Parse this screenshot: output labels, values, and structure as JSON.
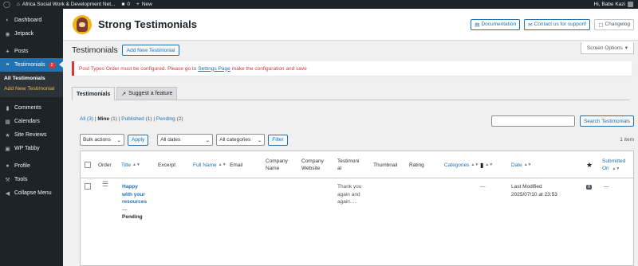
{
  "adminbar": {
    "site_name": "Africa Social Work & Development Net...",
    "comments_count": "0",
    "new_label": "New",
    "greeting": "Hi, Babe Kazi"
  },
  "sidebar": {
    "items": [
      {
        "label": "Dashboard",
        "icon": "dashboard-icon"
      },
      {
        "label": "Jetpack",
        "icon": "jetpack-icon"
      },
      {
        "label": "Posts",
        "icon": "pin-icon"
      },
      {
        "label": "Testimonials",
        "icon": "testimonial-icon",
        "badge": "2"
      },
      {
        "label": "Comments",
        "icon": "comment-icon"
      },
      {
        "label": "Calendars",
        "icon": "calendar-icon"
      },
      {
        "label": "Site Reviews",
        "icon": "review-icon"
      },
      {
        "label": "WP Tabby",
        "icon": "tabs-icon"
      },
      {
        "label": "Profile",
        "icon": "user-icon"
      },
      {
        "label": "Tools",
        "icon": "wrench-icon"
      },
      {
        "label": "Collapse Menu",
        "icon": "collapse-icon"
      }
    ],
    "submenu": [
      "All Testimonials",
      "Add New Testimonial"
    ]
  },
  "header": {
    "plugin_title": "Strong Testimonials",
    "documentation": "Documentation",
    "support": "Contact us for support!",
    "changelog": "Changelog"
  },
  "page": {
    "title": "Testimonials",
    "add_new": "Add New Testimonial",
    "screen_options": "Screen Options"
  },
  "notice": {
    "before": "Post Types Order must be configured. Please go to",
    "link": "Settings Page",
    "after": "make the configuration and save"
  },
  "tabs": [
    "Testimonials",
    "Suggest a feature"
  ],
  "views": {
    "all": "All",
    "all_count": "(3)",
    "mine": "Mine",
    "mine_count": "(1)",
    "published": "Published",
    "published_count": "(1)",
    "pending": "Pending",
    "pending_count": "(2)",
    "sep": "|"
  },
  "search": {
    "button": "Search Testimonials"
  },
  "tablenav": {
    "bulk_actions": "Bulk actions",
    "apply": "Apply",
    "all_dates": "All dates",
    "all_categories": "All categories",
    "filter": "Filter",
    "items": "1 item"
  },
  "columns": {
    "order": "Order",
    "title": "Title",
    "excerpt": "Excerpt",
    "full_name": "Full Name",
    "email": "Email",
    "company_name": [
      "Company",
      "Name"
    ],
    "company_website": [
      "Company",
      "Website"
    ],
    "testimonial": [
      "Testimoni",
      "al"
    ],
    "thumbnail": "Thumbnail",
    "rating": "Rating",
    "categories": "Categories",
    "date": "Date",
    "submitted_on": [
      "Submitted",
      "On"
    ]
  },
  "rows": [
    {
      "title": [
        "Happy",
        "with your",
        "resources"
      ],
      "dash": "—",
      "state": "Pending",
      "testimonial": [
        "Thank you",
        "again and",
        "again....."
      ],
      "comments": "—",
      "date_status": "Last Modified",
      "date": "2025/07/10 at 23:53",
      "star_count": "0",
      "submitted": "—"
    }
  ]
}
